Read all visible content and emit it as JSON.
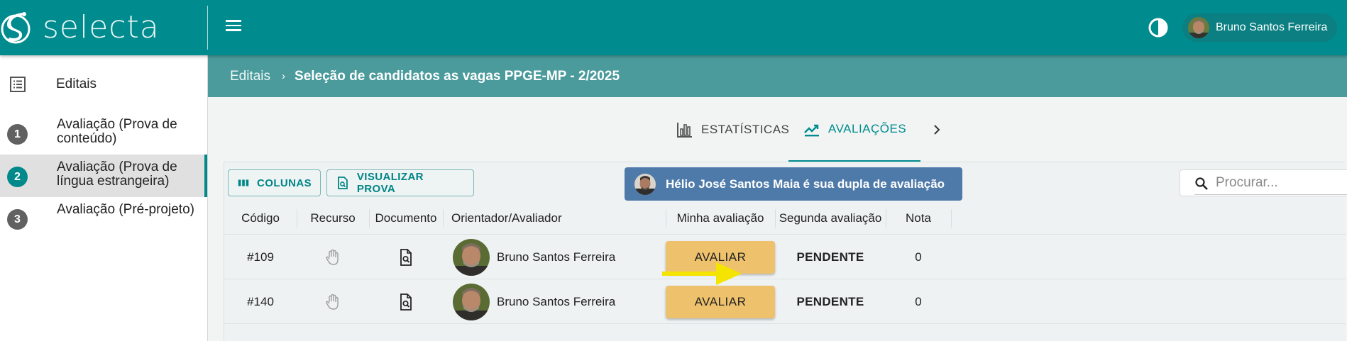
{
  "app": {
    "logo_text": "selecta"
  },
  "header": {
    "user_name": "Bruno Santos Ferreira"
  },
  "sidebar": {
    "editais_label": "Editais",
    "steps": [
      {
        "number": "1",
        "label": "Avaliação (Prova de conteúdo)"
      },
      {
        "number": "2",
        "label": "Avaliação (Prova de língua estrangeira)",
        "active": true
      },
      {
        "number": "3",
        "label": "Avaliação (Pré-projeto)"
      }
    ]
  },
  "breadcrumb": {
    "root": "Editais",
    "current": "Seleção de candidatos as vagas PPGE-MP - 2/2025"
  },
  "tabs": [
    {
      "label": "ESTATÍSTICAS",
      "icon": "bar-chart-icon"
    },
    {
      "label": "AVALIAÇÕES",
      "icon": "trending-up-icon",
      "active": true
    }
  ],
  "toolbar": {
    "colunas_label": "COLUNAS",
    "visualizar_label": "VISUALIZAR PROVA",
    "dupla_text": "Hélio José Santos Maia é sua dupla de avaliação",
    "search_placeholder": "Procurar..."
  },
  "table": {
    "columns": [
      "Código",
      "Recurso",
      "Documento",
      "Orientador/Avaliador",
      "Minha avaliação",
      "Segunda avaliação",
      "Nota"
    ],
    "rows": [
      {
        "codigo": "#109",
        "orientador": "Bruno Santos Ferreira",
        "action": "AVALIAR",
        "segunda": "PENDENTE",
        "nota": "0"
      },
      {
        "codigo": "#140",
        "orientador": "Bruno Santos Ferreira",
        "action": "AVALIAR",
        "segunda": "PENDENTE",
        "nota": "0"
      }
    ]
  },
  "colors": {
    "primary": "#008c8e",
    "crumb_bar": "#4b9b9c",
    "dupla_bg": "#4e7aa9",
    "avaliar_button": "#eec26d",
    "annotation_arrow": "#f5e400"
  }
}
